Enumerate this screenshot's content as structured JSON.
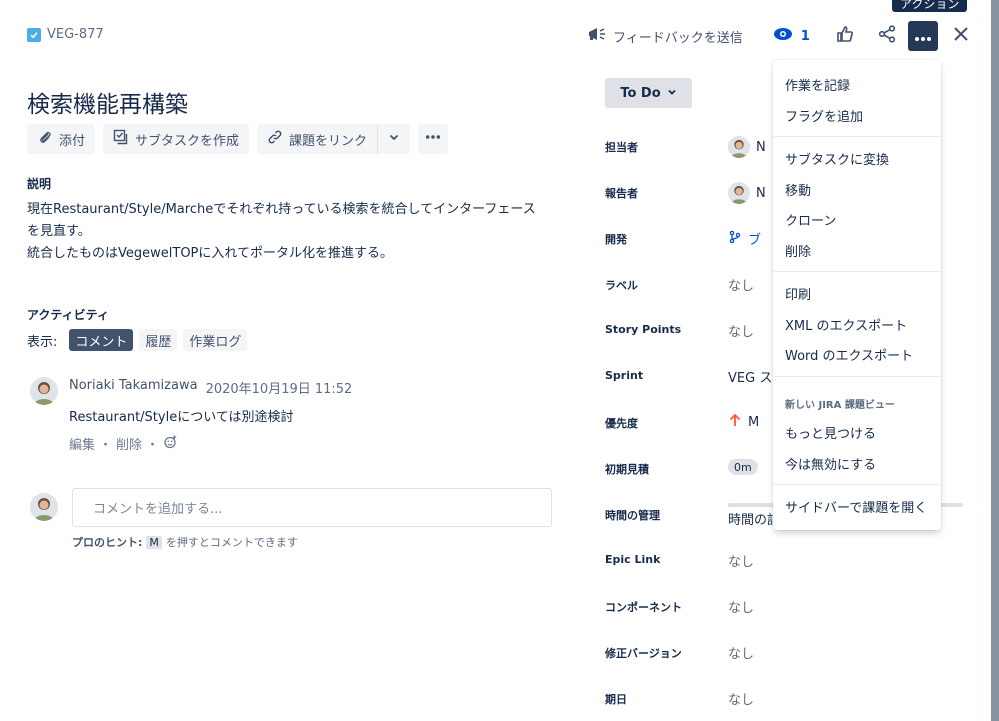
{
  "issue": {
    "key": "VEG-877",
    "summary": "検索機能再構築"
  },
  "header": {
    "feedback_label": "フィードバックを送信",
    "watch_count": "1",
    "tooltip": "アクション"
  },
  "toolbar": {
    "attach": "添付",
    "create_subtask": "サブタスクを作成",
    "link_issue": "課題をリンク"
  },
  "description": {
    "title": "説明",
    "lines": [
      "現在Restaurant/Style/Marcheでそれぞれ持っている検索を統合してインターフェース",
      "を見直す。",
      "統合したものはVegewelTOPに入れてポータル化を推進する。"
    ]
  },
  "activity": {
    "title": "アクティビティ",
    "show_label": "表示:",
    "tabs": [
      "コメント",
      "履歴",
      "作業ログ"
    ]
  },
  "comment": {
    "author": "Noriaki Takamizawa",
    "time": "2020年10月19日 11:52",
    "body": "Restaurant/Styleについては別途検討",
    "edit": "編集",
    "delete": "削除",
    "sep": "・"
  },
  "comment_box": {
    "placeholder": "コメントを追加する...",
    "hint_bold": "プロのヒント:",
    "hint_key": "M",
    "hint_rest": "を押すとコメントできます"
  },
  "status": {
    "label": "To Do"
  },
  "fields": [
    {
      "label": "担当者",
      "value": "N"
    },
    {
      "label": "報告者",
      "value": "N"
    },
    {
      "label": "開発",
      "value": "ブ"
    },
    {
      "label": "ラベル",
      "value": "なし"
    },
    {
      "label": "Story Points",
      "value": "なし"
    },
    {
      "label": "Sprint",
      "value": "VEG ス"
    },
    {
      "label": "優先度",
      "value": "M"
    },
    {
      "label": "初期見積",
      "value": "0m"
    },
    {
      "label": "時間の管理",
      "value": "時間の記"
    },
    {
      "label": "Epic Link",
      "value": "なし"
    },
    {
      "label": "コンポーネント",
      "value": "なし"
    },
    {
      "label": "修正バージョン",
      "value": "なし"
    },
    {
      "label": "期日",
      "value": "なし"
    }
  ],
  "menu": {
    "items": [
      "作業を記録",
      "フラグを追加",
      "サブタスクに変換",
      "移動",
      "クローン",
      "削除",
      "印刷",
      "XML のエクスポート",
      "Word のエクスポート",
      "もっと見つける",
      "今は無効にする",
      "サイドバーで課題を開く"
    ],
    "group_title": "新しい JIRA 課題ビュー"
  },
  "colors": {
    "primary_dark": "#253858",
    "link": "#0052cc",
    "priority": "#ff5630",
    "task": "#4bade8"
  }
}
